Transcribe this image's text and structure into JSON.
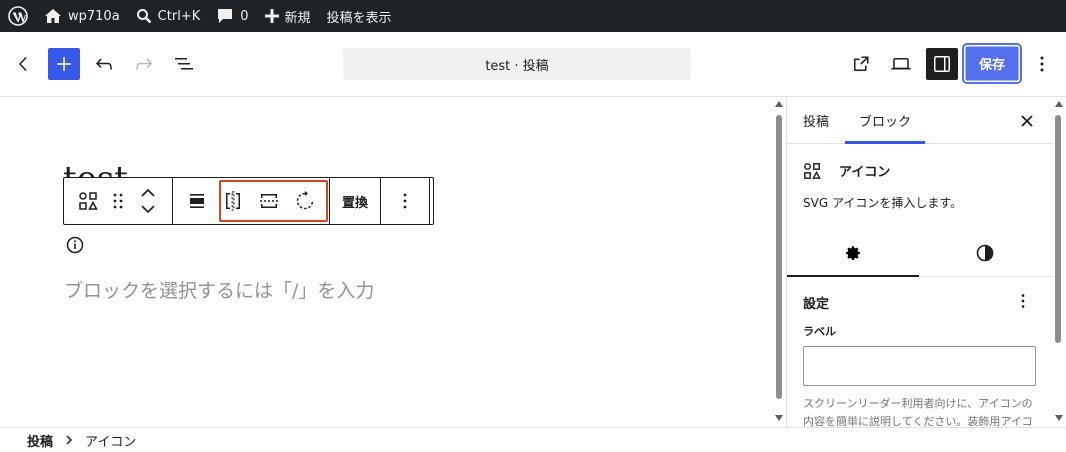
{
  "adminbar": {
    "site_name": "wp710a",
    "search_shortcut": "Ctrl+K",
    "comments_count": "0",
    "new_label": "新規",
    "view_post_label": "投稿を表示"
  },
  "header": {
    "document_title": "test · 投稿",
    "save_label": "保存"
  },
  "canvas": {
    "post_title": "test",
    "replace_label": "置換",
    "placeholder": "ブロックを選択するには「/」を入力"
  },
  "sidebar": {
    "tabs": [
      {
        "label": "投稿"
      },
      {
        "label": "ブロック"
      }
    ],
    "block_name": "アイコン",
    "block_description": "SVG アイコンを挿入します。",
    "panel_title": "設定",
    "field_label": "ラベル",
    "field_value": "",
    "help_text": "スクリーンリーダー利用者向けに、アイコンの内容を簡単に説明してください。装飾用アイコンの場合"
  },
  "breadcrumb": {
    "items": [
      {
        "label": "投稿"
      },
      {
        "label": "アイコン"
      }
    ]
  },
  "colors": {
    "adminbar_bg": "#1d2327",
    "accent": "#3858e9",
    "highlight": "#d7431b"
  }
}
